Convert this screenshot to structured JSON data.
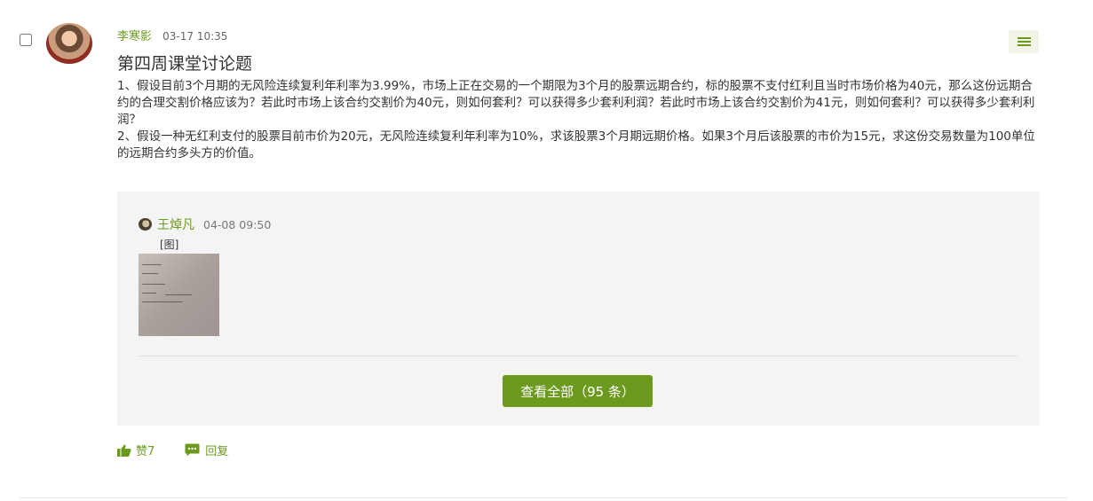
{
  "post": {
    "author": "李寒影",
    "time": "03-17 10:35",
    "title": "第四周课堂讨论题",
    "body": [
      "1、假设目前3个月期的无风险连续复利年利率为3.99%，市场上正在交易的一个期限为3个月的股票远期合约，标的股票不支付红利且当时市场价格为40元，那么这份远期合约的合理交割价格应该为？若此时市场上该合约交割价为40元，则如何套利？可以获得多少套利利润？若此时市场上该合约交割价为41元，则如何套利？可以获得多少套利利润？",
      "2、假设一种无红利支付的股票目前市价为20元，无风险连续复利年利率为10%，求该股票3个月期远期价格。如果3个月后该股票的市价为15元，求这份交易数量为100单位的远期合约多头方的价值。"
    ]
  },
  "reply": {
    "author": "王焯凡",
    "time": "04-08 09:50",
    "text": "[图]",
    "view_all_label": "查看全部（95 条）"
  },
  "actions": {
    "like_label": "赞7",
    "reply_label": "回复"
  },
  "colors": {
    "accent": "#6c9a1f",
    "reply_bg": "#f4f4f4"
  }
}
